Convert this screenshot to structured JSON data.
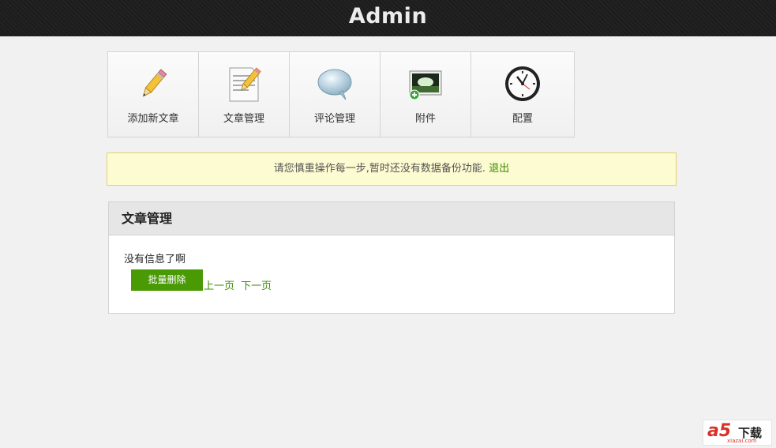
{
  "header": {
    "title": "Admin"
  },
  "nav": {
    "items": [
      {
        "label": "添加新文章",
        "icon": "pencil-icon"
      },
      {
        "label": "文章管理",
        "icon": "document-edit-icon"
      },
      {
        "label": "评论管理",
        "icon": "speech-bubble-icon"
      },
      {
        "label": "附件",
        "icon": "image-add-icon"
      },
      {
        "label": "配置",
        "icon": "clock-icon"
      }
    ]
  },
  "notice": {
    "text": "请您慎重操作每一步,暂时还没有数据备份功能.",
    "logout_label": "退出"
  },
  "panel": {
    "title": "文章管理",
    "empty_message": "没有信息了啊",
    "batch_delete_label": "批量删除",
    "prev_label": "上一页",
    "next_label": "下一页"
  },
  "watermark": {
    "brand": "a5",
    "text": "下载",
    "domain": "xiazai.com"
  }
}
